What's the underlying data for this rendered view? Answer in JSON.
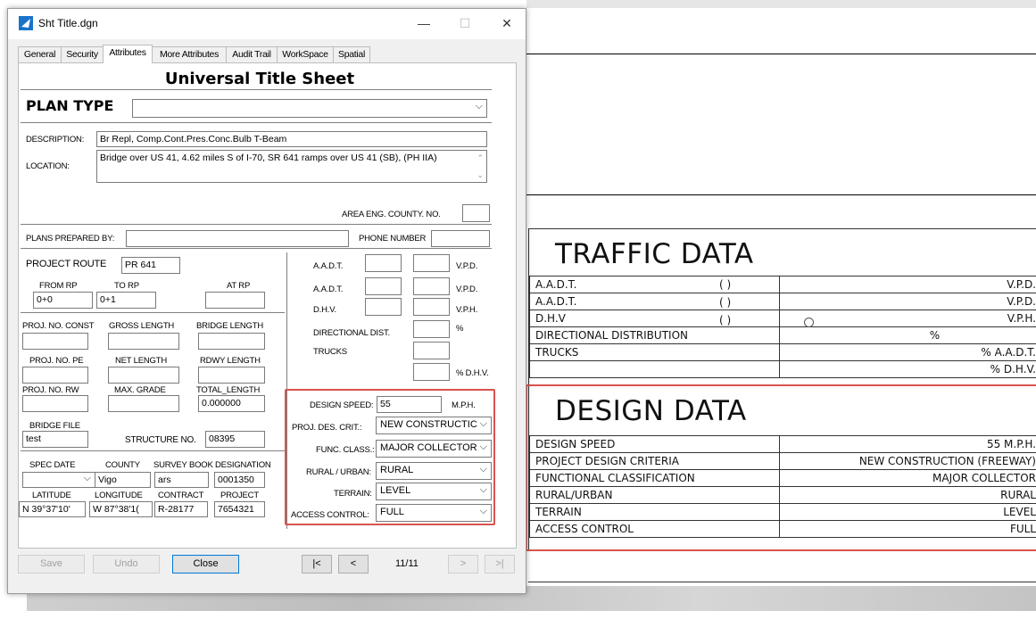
{
  "window": {
    "title": "Sht Title.dgn",
    "minimize": "—",
    "maximize": "☐",
    "close": "✕"
  },
  "tabs": [
    {
      "label": "General"
    },
    {
      "label": "Security"
    },
    {
      "label": "Attributes"
    },
    {
      "label": "More Attributes"
    },
    {
      "label": "Audit Trail"
    },
    {
      "label": "WorkSpace"
    },
    {
      "label": "Spatial"
    }
  ],
  "form": {
    "heading": "Universal Title Sheet",
    "plan_type_label": "PLAN TYPE",
    "plan_type_value": "",
    "description_label": "DESCRIPTION:",
    "description_value": "Br Repl, Comp.Cont.Pres.Conc.Bulb T-Beam",
    "location_label": "LOCATION:",
    "location_value": "Bridge over US 41, 4.62 miles S of I-70, SR 641 ramps over US 41 (SB), (PH IIA)",
    "area_eng_label": "AREA ENG. COUNTY. NO.",
    "area_eng_value": "",
    "plans_prepared_label": "PLANS PREPARED BY:",
    "plans_prepared_value": "",
    "phone_label": "PHONE NUMBER",
    "phone_value": "",
    "project_route_label": "PROJECT ROUTE",
    "project_route_value": "PR 641",
    "from_rp_label": "FROM RP",
    "from_rp_value": "0+0",
    "to_rp_label": "TO RP",
    "to_rp_value": "0+1",
    "at_rp_label": "AT RP",
    "at_rp_value": "",
    "proj_no_const_label": "PROJ. NO. CONST",
    "proj_no_const_value": "",
    "gross_length_label": "GROSS LENGTH",
    "gross_length_value": "",
    "bridge_length_label": "BRIDGE LENGTH",
    "bridge_length_value": "",
    "proj_no_pe_label": "PROJ. NO. PE",
    "proj_no_pe_value": "",
    "net_length_label": "NET LENGTH",
    "net_length_value": "",
    "rdwy_length_label": "RDWY LENGTH",
    "rdwy_length_value": "",
    "proj_no_rw_label": "PROJ. NO. RW",
    "proj_no_rw_value": "",
    "max_grade_label": "MAX. GRADE",
    "max_grade_value": "",
    "total_length_label": "TOTAL_LENGTH",
    "total_length_value": "0.000000",
    "bridge_file_label": "BRIDGE FILE",
    "bridge_file_value": "test",
    "structure_no_label": "STRUCTURE NO.",
    "structure_no_value": "08395",
    "spec_date_label": "SPEC DATE",
    "spec_date_value": "",
    "county_label": "COUNTY",
    "county_value": "Vigo",
    "survey_book_label": "SURVEY BOOK",
    "survey_book_value": "ars",
    "designation_label": "DESIGNATION",
    "designation_value": "0001350",
    "latitude_label": "LATITUDE",
    "latitude_value": "N 39°37'10'",
    "longitude_label": "LONGITUDE",
    "longitude_value": "W 87°38'1(",
    "contract_label": "CONTRACT",
    "contract_value": "R-28177",
    "project_label": "PROJECT",
    "project_value": "7654321",
    "aadt1_label": "A.A.D.T.",
    "aadt2_label": "A.A.D.T.",
    "dhv_label": "D.H.V.",
    "vpd1_label": "V.P.D.",
    "vpd2_label": "V.P.D.",
    "vph_label": "V.P.H.",
    "directional_label": "DIRECTIONAL DIST.",
    "percent_label": "%",
    "trucks_label": "TRUCKS",
    "pct_dhv_label": "% D.H.V.",
    "design_speed_label": "DESIGN SPEED:",
    "design_speed_value": "55",
    "mph_label": "M.P.H.",
    "proj_des_crit_label": "PROJ. DES. CRIT.:",
    "proj_des_crit_value": "NEW CONSTRUCTIC",
    "func_class_label": "FUNC. CLASS.:",
    "func_class_value": "MAJOR COLLECTOR",
    "rural_urban_label": "RURAL / URBAN:",
    "rural_urban_value": "RURAL",
    "terrain_label": "TERRAIN:",
    "terrain_value": "LEVEL",
    "access_control_label": "ACCESS CONTROL:",
    "access_control_value": "FULL"
  },
  "footer": {
    "save": "Save",
    "undo": "Undo",
    "close": "Close",
    "first": "|<",
    "prev": "<",
    "page": "11/11",
    "next": ">",
    "last": ">|"
  },
  "drawing": {
    "traffic_title": "TRAFFIC DATA",
    "traffic_rows": [
      {
        "label": "A.A.D.T.",
        "paren": "(        )",
        "value": "V.P.D."
      },
      {
        "label": "A.A.D.T.",
        "paren": "(        )",
        "value": "V.P.D."
      },
      {
        "label": "D.H.V",
        "paren": "(        )",
        "value": "V.P.H."
      },
      {
        "label": "DIRECTIONAL DISTRIBUTION",
        "paren": "",
        "value": "%"
      },
      {
        "label": "TRUCKS",
        "paren": "",
        "value": "% A.A.D.T."
      },
      {
        "label": "",
        "paren": "",
        "value": "% D.H.V."
      }
    ],
    "design_title": "DESIGN DATA",
    "design_rows": [
      {
        "label": "DESIGN SPEED",
        "value": "55 M.P.H."
      },
      {
        "label": "PROJECT DESIGN CRITERIA",
        "value": "NEW CONSTRUCTION (FREEWAY)"
      },
      {
        "label": "FUNCTIONAL CLASSIFICATION",
        "value": "MAJOR COLLECTOR"
      },
      {
        "label": "RURAL/URBAN",
        "value": "RURAL"
      },
      {
        "label": "TERRAIN",
        "value": "LEVEL"
      },
      {
        "label": "ACCESS CONTROL",
        "value": "FULL"
      }
    ]
  },
  "colors": {
    "highlight": "#d9534f",
    "focus": "#0078d7"
  }
}
